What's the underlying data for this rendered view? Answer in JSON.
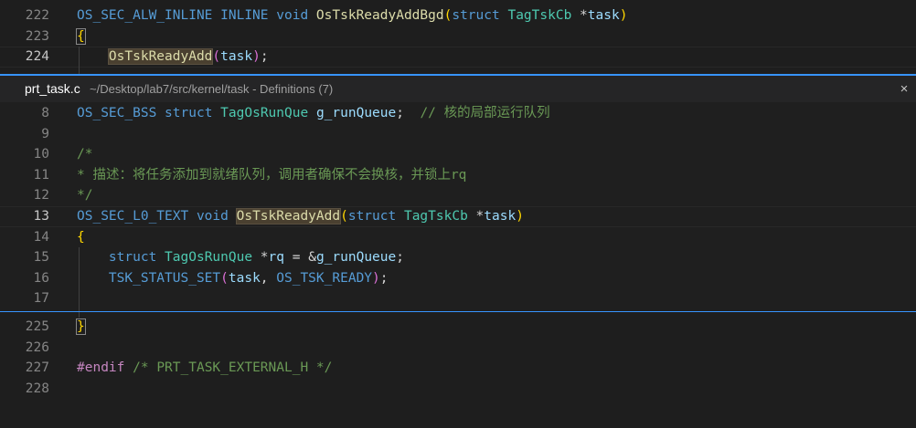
{
  "editor_top": {
    "lines": [
      {
        "num": "222",
        "tokens": [
          {
            "c": "mc",
            "t": "OS_SEC_ALW_INLINE"
          },
          {
            "c": "pu",
            "t": " "
          },
          {
            "c": "mc",
            "t": "INLINE"
          },
          {
            "c": "pu",
            "t": " "
          },
          {
            "c": "kw",
            "t": "void"
          },
          {
            "c": "pu",
            "t": " "
          },
          {
            "c": "fn",
            "t": "OsTskReadyAddBgd"
          },
          {
            "c": "b1",
            "t": "("
          },
          {
            "c": "kw",
            "t": "struct"
          },
          {
            "c": "pu",
            "t": " "
          },
          {
            "c": "ty",
            "t": "TagTskCb"
          },
          {
            "c": "pu",
            "t": " *"
          },
          {
            "c": "id",
            "t": "task"
          },
          {
            "c": "b1",
            "t": ")"
          }
        ]
      },
      {
        "num": "223",
        "tokens": [
          {
            "c": "b1 hl-brace",
            "t": "{"
          }
        ]
      },
      {
        "num": "224",
        "active": true,
        "tokens": [
          {
            "c": "pu",
            "t": "    "
          },
          {
            "c": "fn hl-word",
            "t": "OsTskReadyAdd"
          },
          {
            "c": "b2",
            "t": "("
          },
          {
            "c": "id",
            "t": "task"
          },
          {
            "c": "b2",
            "t": ")"
          },
          {
            "c": "pu",
            "t": ";"
          }
        ]
      }
    ]
  },
  "peek": {
    "file": "prt_task.c",
    "path": "~/Desktop/lab7/src/kernel/task - Definitions (7)",
    "close_icon": "×",
    "lines": [
      {
        "num": "8",
        "tokens": [
          {
            "c": "mc",
            "t": "OS_SEC_BSS"
          },
          {
            "c": "pu",
            "t": " "
          },
          {
            "c": "kw",
            "t": "struct"
          },
          {
            "c": "pu",
            "t": " "
          },
          {
            "c": "ty",
            "t": "TagOsRunQue"
          },
          {
            "c": "pu",
            "t": " "
          },
          {
            "c": "id",
            "t": "g_runQueue"
          },
          {
            "c": "pu",
            "t": ";  "
          },
          {
            "c": "cm",
            "t": "// 核的局部运行队列"
          }
        ]
      },
      {
        "num": "9",
        "tokens": []
      },
      {
        "num": "10",
        "tokens": [
          {
            "c": "cm",
            "t": "/*"
          }
        ]
      },
      {
        "num": "11",
        "tokens": [
          {
            "c": "cm",
            "t": "* 描述：将任务添加到就绪队列，调用者确保不会换核，并锁上rq"
          }
        ]
      },
      {
        "num": "12",
        "tokens": [
          {
            "c": "cm",
            "t": "*/"
          }
        ]
      },
      {
        "num": "13",
        "active": true,
        "tokens": [
          {
            "c": "mc",
            "t": "OS_SEC_L0_TEXT"
          },
          {
            "c": "pu",
            "t": " "
          },
          {
            "c": "kw",
            "t": "void"
          },
          {
            "c": "pu",
            "t": " "
          },
          {
            "c": "fn hl-word",
            "t": "OsTskReadyAdd"
          },
          {
            "c": "b1",
            "t": "("
          },
          {
            "c": "kw",
            "t": "struct"
          },
          {
            "c": "pu",
            "t": " "
          },
          {
            "c": "ty",
            "t": "TagTskCb"
          },
          {
            "c": "pu",
            "t": " *"
          },
          {
            "c": "id",
            "t": "task"
          },
          {
            "c": "b1",
            "t": ")"
          }
        ]
      },
      {
        "num": "14",
        "tokens": [
          {
            "c": "b1",
            "t": "{"
          }
        ]
      },
      {
        "num": "15",
        "tokens": [
          {
            "c": "pu",
            "t": "    "
          },
          {
            "c": "kw",
            "t": "struct"
          },
          {
            "c": "pu",
            "t": " "
          },
          {
            "c": "ty",
            "t": "TagOsRunQue"
          },
          {
            "c": "pu",
            "t": " *"
          },
          {
            "c": "id",
            "t": "rq"
          },
          {
            "c": "pu",
            "t": " = &"
          },
          {
            "c": "id",
            "t": "g_runQueue"
          },
          {
            "c": "pu",
            "t": ";"
          }
        ]
      },
      {
        "num": "16",
        "tokens": [
          {
            "c": "pu",
            "t": "    "
          },
          {
            "c": "mc",
            "t": "TSK_STATUS_SET"
          },
          {
            "c": "b2",
            "t": "("
          },
          {
            "c": "id",
            "t": "task"
          },
          {
            "c": "pu",
            "t": ", "
          },
          {
            "c": "mc",
            "t": "OS_TSK_READY"
          },
          {
            "c": "b2",
            "t": ")"
          },
          {
            "c": "pu",
            "t": ";"
          }
        ]
      },
      {
        "num": "17",
        "tokens": []
      }
    ]
  },
  "editor_bottom": {
    "lines": [
      {
        "num": "225",
        "tokens": [
          {
            "c": "b1 hl-brace",
            "t": "}"
          }
        ]
      },
      {
        "num": "226",
        "tokens": []
      },
      {
        "num": "227",
        "tokens": [
          {
            "c": "pp",
            "t": "#endif"
          },
          {
            "c": "pu",
            "t": " "
          },
          {
            "c": "cm",
            "t": "/* PRT_TASK_EXTERNAL_H */"
          }
        ]
      },
      {
        "num": "228",
        "tokens": []
      }
    ]
  }
}
